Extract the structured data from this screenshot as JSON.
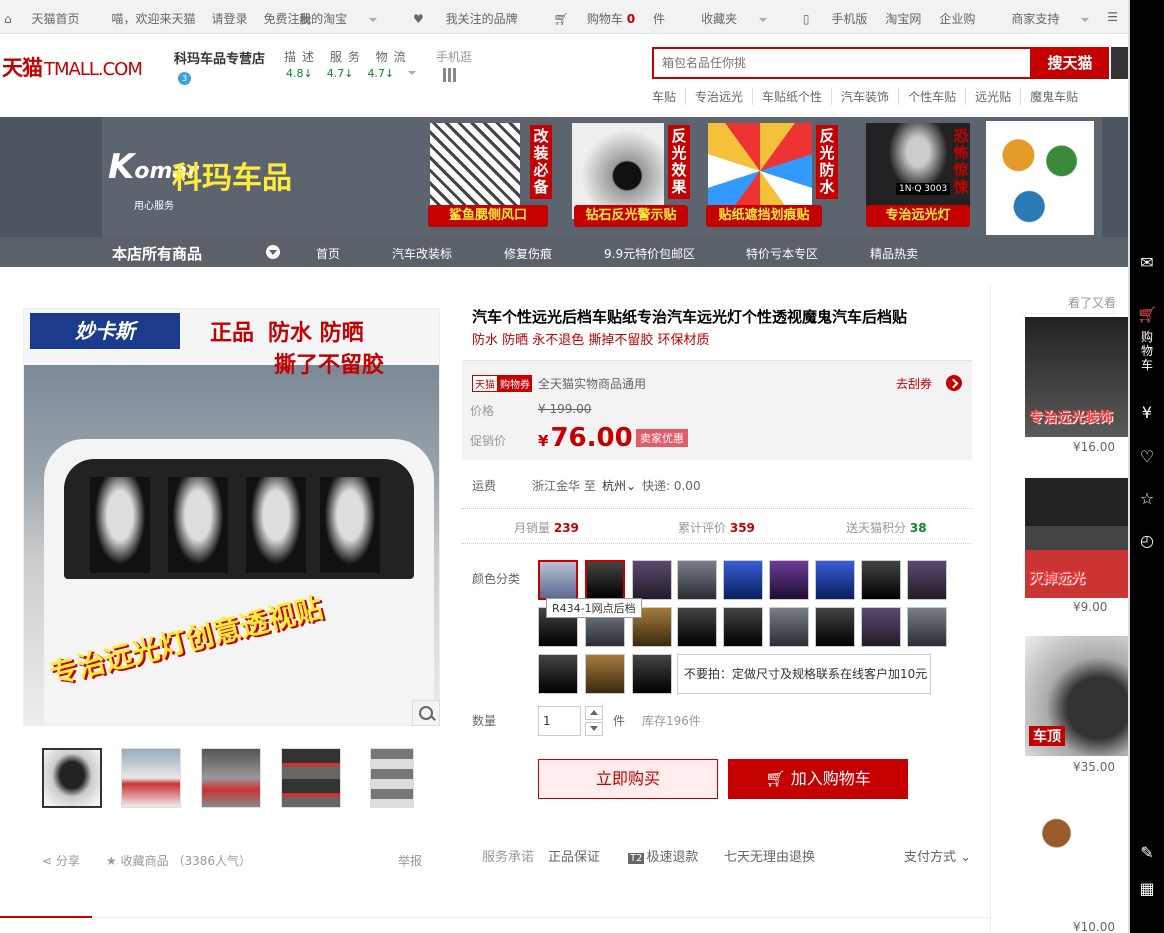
{
  "colors": {
    "brand": "#c40000",
    "accent": "#ffeded",
    "nav": "#5b6169",
    "success": "#0a8a2a"
  },
  "topbar": {
    "left": [
      "天猫首页",
      "喵，欢迎来天猫",
      "请登录",
      "免费注册"
    ],
    "right": [
      "我的淘宝",
      "我关注的品牌",
      "购物车",
      "0",
      "件",
      "收藏夹",
      "手机版",
      "淘宝网",
      "企业购",
      "商家支持"
    ]
  },
  "header": {
    "logo_cn": "天猫",
    "logo_en": "TMALL.COM",
    "shop_name": "科玛车品专营店",
    "dsr_label": "描述 服务 物流",
    "dsr_values": [
      "4.8↓",
      "4.7↓",
      "4.7↓"
    ],
    "mobile_label": "手机逛",
    "search_placeholder": "箱包名品任你挑",
    "search_button": "搜天猫",
    "hot_words": [
      "车贴",
      "专治远光",
      "车贴纸个性",
      "汽车装饰",
      "个性车贴",
      "远光贴",
      "魔鬼车贴"
    ]
  },
  "banner": {
    "brand": "omar",
    "brand_cn": "科玛车品",
    "brand_tag": "用心服务",
    "products": [
      {
        "badge": "鲨鱼腮侧风口",
        "vertical": "改装必备"
      },
      {
        "badge": "钻石反光警示贴",
        "vertical": "反光效果"
      },
      {
        "badge": "贴纸遮挡划痕贴",
        "vertical": "反光防水"
      },
      {
        "badge": "专治远光灯",
        "vertical": "恐怖惊悚"
      }
    ],
    "plate": "1N·Q 3003"
  },
  "nav": {
    "all": "本店所有商品",
    "items": [
      "首页",
      "汽车改装标",
      "修复伤痕",
      "9.9元特价包邮区",
      "特价亏本专区",
      "精品热卖"
    ]
  },
  "gallery": {
    "main_logo": "妙卡斯",
    "main_tag1": "正品",
    "main_tag2": "防水 防晒",
    "main_tag3": "撕了不留胶",
    "main_slogan": "专治远光灯创意透视贴",
    "share": "分享",
    "fav": "收藏商品",
    "fav_count": "（3386人气）",
    "report": "举报"
  },
  "product": {
    "title": "汽车个性远光后档车贴纸专治汽车远光灯个性透视魔鬼汽车后档贴",
    "subtitle": "防水 防晒 永不退色 撕掉不留胶 环保材质",
    "coupon_tm": "天猫",
    "coupon_tag": "购物券",
    "coupon_text": "全天猫实物商品通用",
    "coupon_link": "去刮券",
    "price_label": "价格",
    "old_price": "¥ 199.00",
    "promo_label": "促销价",
    "promo_currency": "¥",
    "promo_price": "76.00",
    "promo_badge": "卖家优惠",
    "ship_label": "运费",
    "ship_from": "浙江金华",
    "ship_to_word": "至",
    "ship_to": "杭州",
    "ship_fee": "快递: 0.00",
    "stats": [
      {
        "label": "月销量",
        "value": "239"
      },
      {
        "label": "累计评价",
        "value": "359"
      },
      {
        "label": "送天猫积分",
        "value": "38"
      }
    ],
    "color_label": "颜色分类",
    "tooltip": "R434-1网点后档",
    "custom_option": "不要拍：定做尺寸及规格联系在线客户加10元",
    "qty_label": "数量",
    "qty_value": "1",
    "qty_unit": "件",
    "stock": "库存196件",
    "buy_now": "立即购买",
    "add_cart": "加入购物车",
    "promise_label": "服务承诺",
    "promises": [
      "正品保证",
      "极速退款",
      "七天无理由退换"
    ],
    "t2": "T2",
    "payment": "支付方式"
  },
  "recommend": {
    "title": "看了又看",
    "items": [
      {
        "text": "专治远光装饰",
        "price": "¥16.00"
      },
      {
        "text": "灭掉远光",
        "price": "¥9.00"
      },
      {
        "text": "车顶",
        "price": "¥35.00"
      },
      {
        "text": "",
        "price": "¥10.00"
      }
    ]
  },
  "toolbar": {
    "cart_label": "购物车"
  }
}
